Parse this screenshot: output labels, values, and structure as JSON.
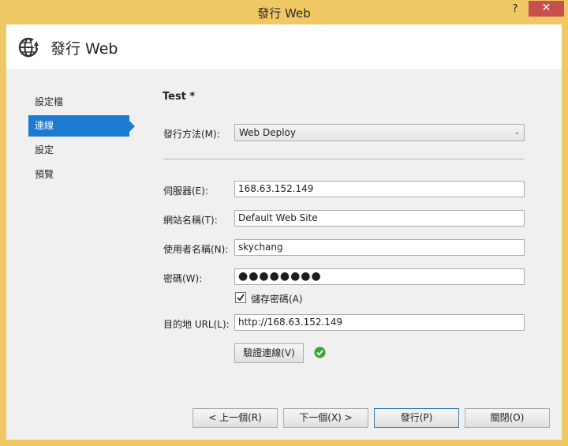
{
  "window": {
    "title": "發行 Web",
    "help_label": "?",
    "close_label": "✕"
  },
  "header": {
    "icon": "globe-publish-icon",
    "title": "發行 Web"
  },
  "nav": {
    "items": [
      {
        "label": "設定檔"
      },
      {
        "label": "連線"
      },
      {
        "label": "設定"
      },
      {
        "label": "預覽"
      }
    ],
    "active_index": 1
  },
  "profile": {
    "name": "Test *"
  },
  "form": {
    "method_label": "發行方法(M):",
    "method_value": "Web Deploy",
    "server_label": "伺服器(E):",
    "server_value": "168.63.152.149",
    "site_label": "網站名稱(T):",
    "site_value": "Default Web Site",
    "user_label": "使用者名稱(N):",
    "user_value": "skychang",
    "password_label": "密碼(W):",
    "password_value": "●●●●●●●●",
    "save_password_label": "儲存密碼(A)",
    "save_password_checked": true,
    "dest_label": "目的地 URL(L):",
    "dest_value": "http://168.63.152.149",
    "validate_label": "驗證連線(V)",
    "validate_status": "success-check-icon"
  },
  "footer": {
    "prev_label": "< 上一個(R)",
    "next_label": "下一個(X) >",
    "publish_label": "發行(P)",
    "close_label": "關閉(O)"
  },
  "colors": {
    "titlebar": "#f0c864",
    "accent": "#1c7bd0",
    "close_button": "#c7504b",
    "success": "#3aa335"
  }
}
